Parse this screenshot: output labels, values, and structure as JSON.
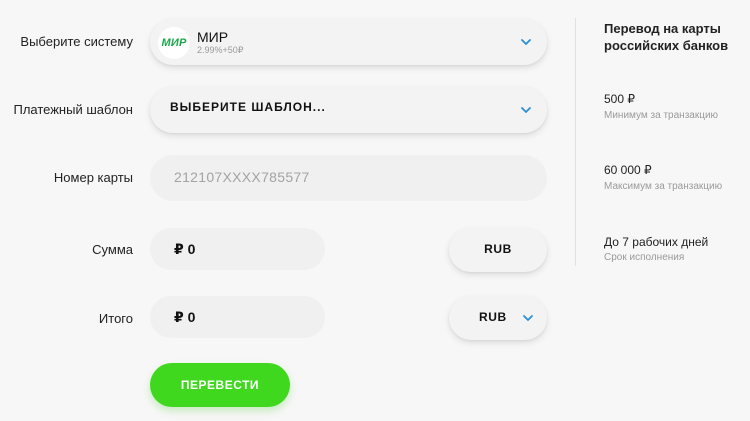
{
  "form": {
    "system": {
      "label": "Выберите систему",
      "selected_name": "МИР",
      "logo_text": "МИР",
      "fee": "2.99%+50₽",
      "icon": "chevron-down-icon"
    },
    "template": {
      "label": "Платежный шаблон",
      "value": "ВЫБЕРИТЕ ШАБЛОН...",
      "icon": "chevron-down-icon"
    },
    "card": {
      "label": "Номер карты",
      "placeholder": "212107XXXX785577"
    },
    "sum": {
      "label": "Сумма",
      "currency_sign": "₽",
      "value": "0",
      "currency": "RUB"
    },
    "total": {
      "label": "Итого",
      "currency_sign": "₽",
      "value": "0",
      "currency": "RUB",
      "icon": "chevron-down-icon"
    },
    "submit_label": "ПЕРЕВЕСТИ"
  },
  "sidebar": {
    "title": "Перевод на карты российских банков",
    "min_value": "500 ₽",
    "min_caption": "Минимум за транзакцию",
    "max_value": "60 000 ₽",
    "max_caption": "Максимум за транзакцию",
    "term_value": "До 7 рабочих дней",
    "term_caption": "Срок исполнения"
  },
  "colors": {
    "accent_green": "#3fd81e",
    "chevron_blue": "#2a8fd6",
    "mir_green": "#1ca64c"
  }
}
